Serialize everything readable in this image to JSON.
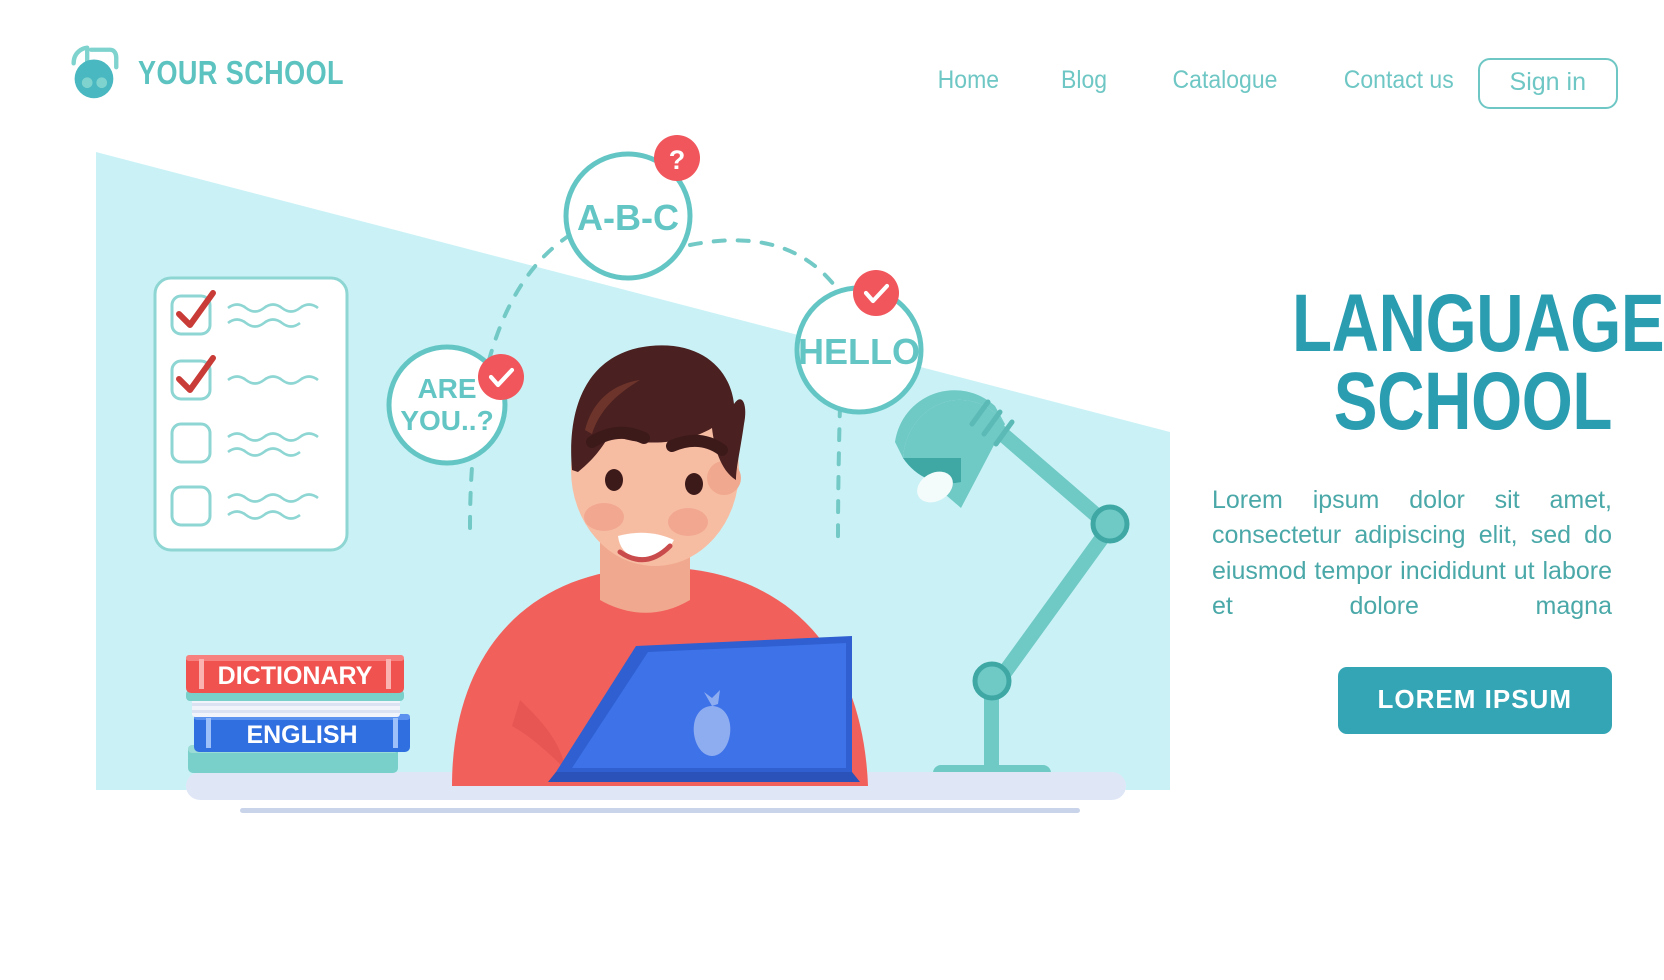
{
  "brand": {
    "name": "YOUR SCHOOL",
    "logo_icon": "school-bag-icon",
    "color": "#5cc3c0"
  },
  "nav": {
    "items": [
      {
        "label": "Home",
        "name": "nav-home"
      },
      {
        "label": "Blog",
        "name": "nav-blog"
      },
      {
        "label": "Catalogue",
        "name": "nav-catalogue"
      },
      {
        "label": "Contact us",
        "name": "nav-contact-us"
      }
    ],
    "signin_label": "Sign in"
  },
  "hero": {
    "title_line1": "LANGUAGE",
    "title_line2": "SCHOOL",
    "paragraph": "Lorem ipsum dolor sit amet, consectetur adipiscing elit, sed do eiusmod tempor incididunt ut labore et dolore magna",
    "cta_label": "LOREM IPSUM",
    "title_color": "#2a9db1",
    "paragraph_color": "#4aa8a8",
    "cta_bg": "#33a5b4",
    "cta_text_color": "#ffffff"
  },
  "illustration": {
    "background_color": "#caf2f6",
    "bubbles": [
      {
        "name": "bubble-abc",
        "text": "A-B-C",
        "badge": "question-mark-badge",
        "badge_glyph": "?"
      },
      {
        "name": "bubble-hello",
        "text": "HELLO",
        "badge": "check-badge",
        "badge_glyph": "check"
      },
      {
        "name": "bubble-are-you",
        "text_line1": "ARE",
        "text_line2": "YOU..?",
        "badge": "check-badge",
        "badge_glyph": "check"
      }
    ],
    "books": [
      {
        "name": "book-dictionary",
        "title": "DICTIONARY",
        "color": "#f0534f"
      },
      {
        "name": "book-english",
        "title": "ENGLISH",
        "color": "#2f6fe0"
      }
    ],
    "checklist": {
      "name": "checklist-card",
      "items": [
        {
          "checked": true
        },
        {
          "checked": true
        },
        {
          "checked": false
        },
        {
          "checked": false
        }
      ],
      "check_color": "#cc3333"
    },
    "desk_lamp": {
      "name": "desk-lamp",
      "color": "#6fc9c5"
    },
    "laptop": {
      "name": "laptop",
      "color": "#3d72e8",
      "logo": "pineapple-logo"
    },
    "person": {
      "name": "student-character",
      "shirt_color": "#f2605c",
      "hair_color": "#4a2020"
    },
    "badge_color": "#f0565c"
  }
}
